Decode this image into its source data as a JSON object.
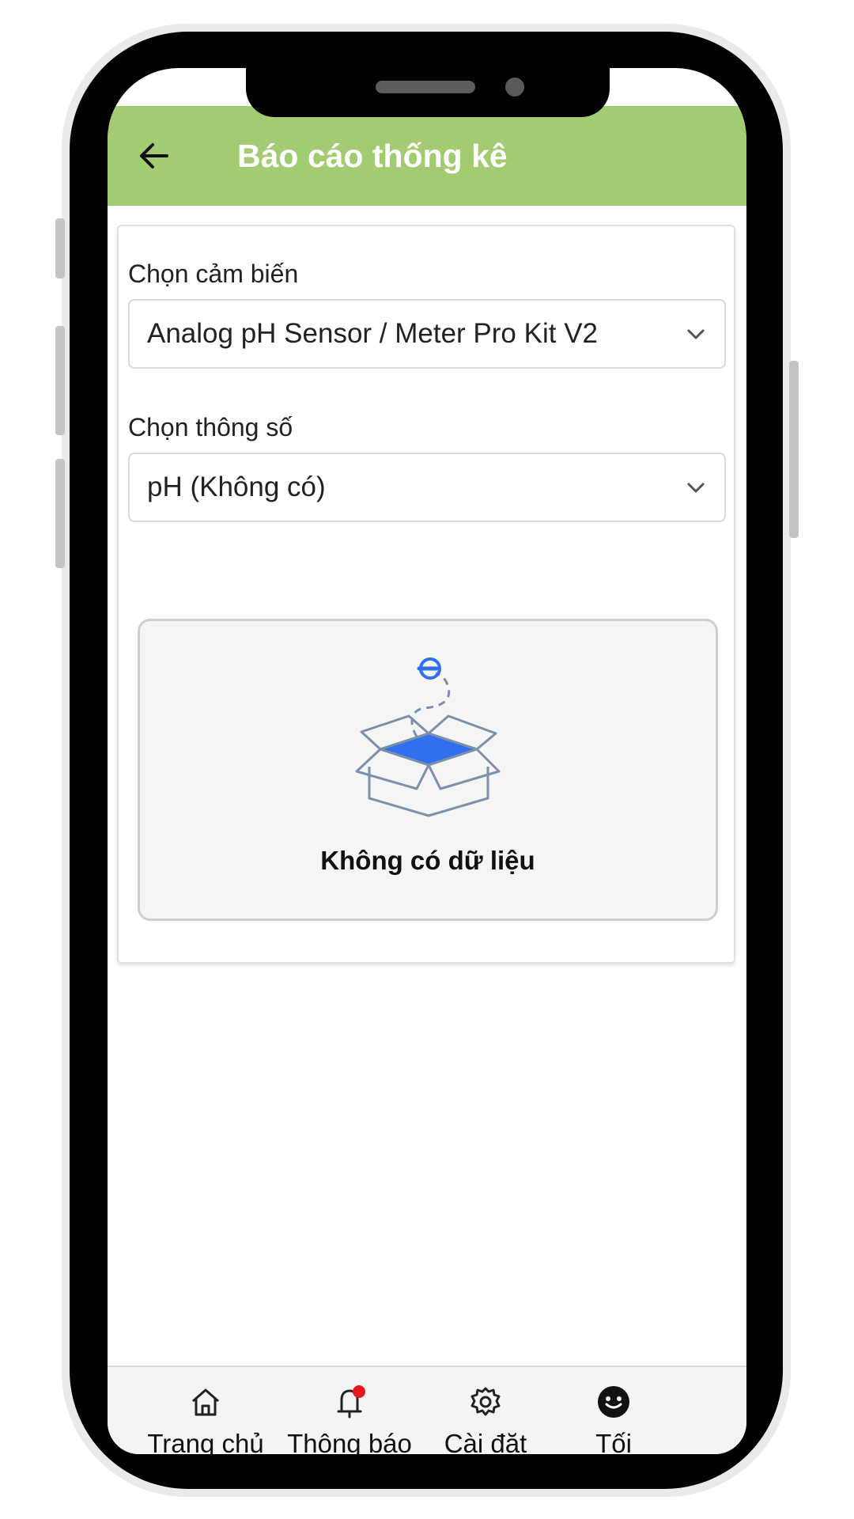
{
  "header": {
    "title": "Báo cáo thống kê"
  },
  "sensor_select": {
    "label": "Chọn cảm biến",
    "value": "Analog pH Sensor / Meter Pro Kit V2"
  },
  "param_select": {
    "label": "Chọn thông số",
    "value": "pH (Không có)"
  },
  "empty_state": {
    "message": "Không có dữ liệu"
  },
  "bottom_nav": {
    "items": [
      {
        "label": "Trang chủ",
        "icon": "home-icon"
      },
      {
        "label": "Thông báo",
        "icon": "bell-icon",
        "badge": true
      },
      {
        "label": "Cài đặt",
        "icon": "gear-icon"
      },
      {
        "label": "Tối",
        "icon": "dark-mode-icon"
      }
    ]
  },
  "colors": {
    "header_bg": "#a3cb72",
    "accent_blue": "#2f6ff0",
    "badge_red": "#e8161d"
  }
}
